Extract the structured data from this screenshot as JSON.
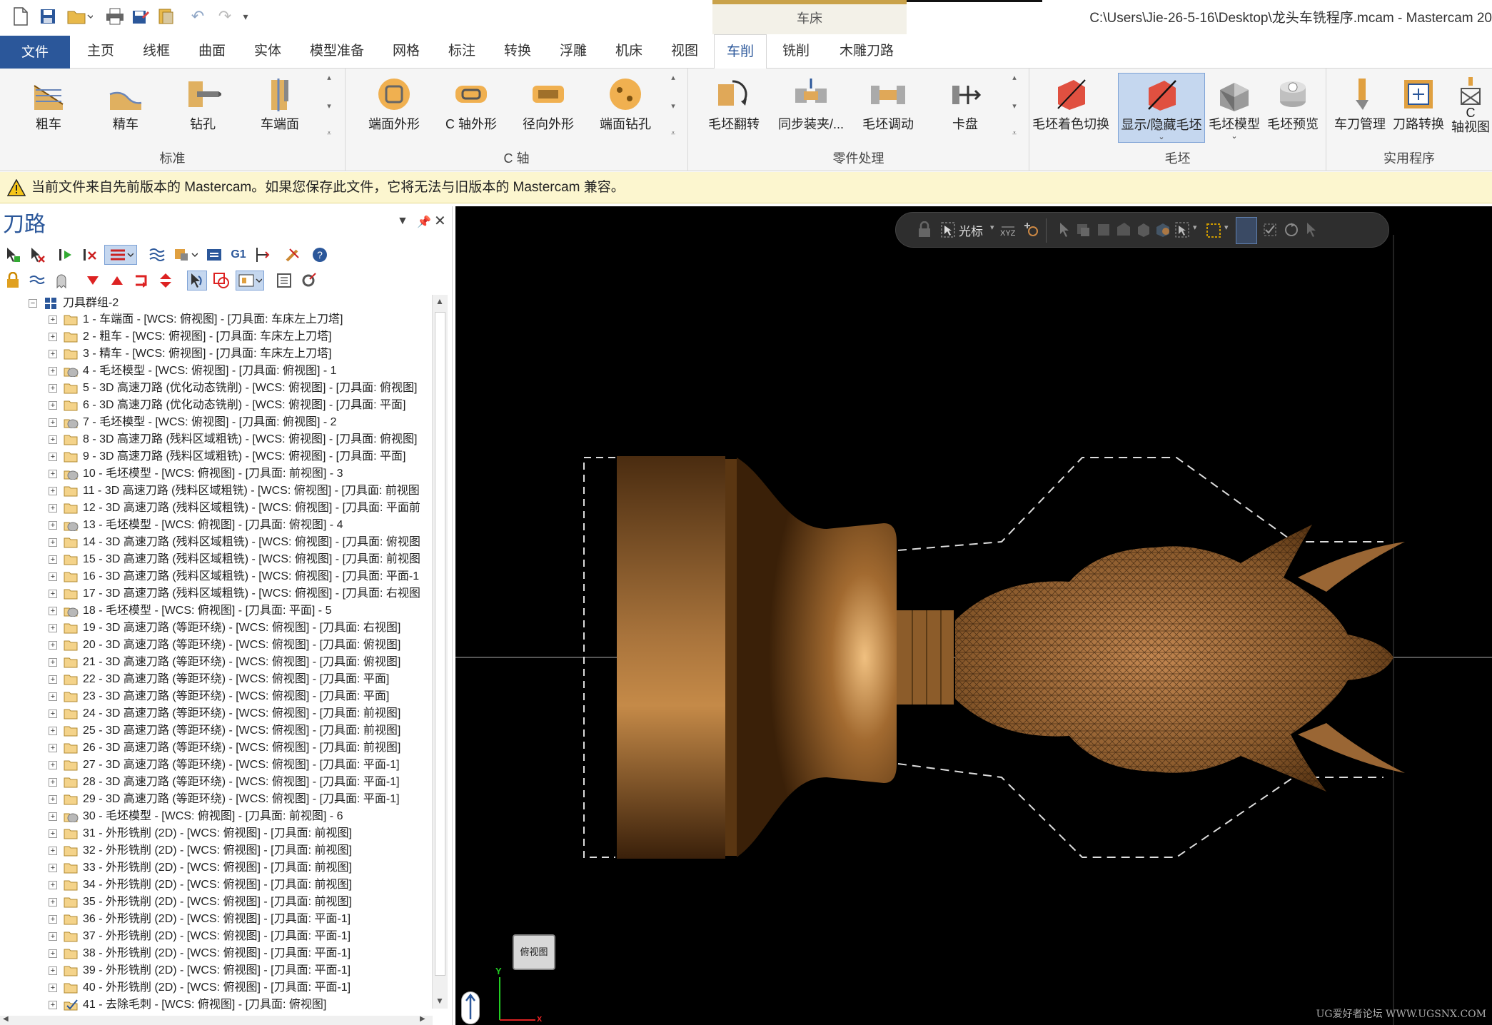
{
  "window": {
    "title": "C:\\Users\\Jie-26-5-16\\Desktop\\龙头车铣程序.mcam - Mastercam 20",
    "context_group": "车床"
  },
  "tabs": [
    {
      "label": "文件"
    },
    {
      "label": "主页"
    },
    {
      "label": "线框"
    },
    {
      "label": "曲面"
    },
    {
      "label": "实体"
    },
    {
      "label": "模型准备"
    },
    {
      "label": "网格"
    },
    {
      "label": "标注"
    },
    {
      "label": "转换"
    },
    {
      "label": "浮雕"
    },
    {
      "label": "机床"
    },
    {
      "label": "视图"
    },
    {
      "label": "车削"
    },
    {
      "label": "铣削"
    },
    {
      "label": "木雕刀路"
    }
  ],
  "ribbon": {
    "standard": {
      "label": "标准",
      "buttons": [
        "粗车",
        "精车",
        "钻孔",
        "车端面"
      ]
    },
    "c_axis": {
      "label": "C 轴",
      "buttons": [
        "端面外形",
        "C 轴外形",
        "径向外形",
        "端面钻孔"
      ]
    },
    "part_handling": {
      "label": "零件处理",
      "buttons": [
        "毛坯翻转",
        "同步装夹/...",
        "毛坯调动",
        "卡盘"
      ]
    },
    "stock": {
      "label": "毛坯",
      "buttons": [
        "毛坯着色切换",
        "显示/隐藏毛坯",
        "毛坯模型",
        "毛坯预览"
      ]
    },
    "utilities": {
      "label": "实用程序",
      "buttons": [
        "车刀管理",
        "刀路转换",
        "C",
        "轴视图"
      ]
    }
  },
  "warning": "当前文件来自先前版本的 Mastercam。如果您保存此文件，它将无法与旧版本的 Mastercam 兼容。",
  "panel": {
    "title": "刀路",
    "root": "刀具群组-2",
    "rows": [
      {
        "text": "1 - 车端面 - [WCS: 俯视图] - [刀具面: 车床左上刀塔]",
        "icon": "folder"
      },
      {
        "text": "2 - 粗车 - [WCS: 俯视图] - [刀具面: 车床左上刀塔]",
        "icon": "folder"
      },
      {
        "text": "3 - 精车 - [WCS: 俯视图] - [刀具面: 车床左上刀塔]",
        "icon": "folder"
      },
      {
        "text": "4 - 毛坯模型 - [WCS: 俯视图] - [刀具面: 俯视图] - 1",
        "icon": "stock"
      },
      {
        "text": "5 - 3D 高速刀路 (优化动态铣削) - [WCS: 俯视图] - [刀具面: 俯视图]",
        "icon": "folder"
      },
      {
        "text": "6 - 3D 高速刀路 (优化动态铣削) - [WCS: 俯视图] - [刀具面: 平面]",
        "icon": "folder"
      },
      {
        "text": "7 - 毛坯模型 - [WCS: 俯视图] - [刀具面: 俯视图] - 2",
        "icon": "stock"
      },
      {
        "text": "8 - 3D 高速刀路 (残料区域粗铣) - [WCS: 俯视图] - [刀具面: 俯视图]",
        "icon": "folder"
      },
      {
        "text": "9 - 3D 高速刀路 (残料区域粗铣) - [WCS: 俯视图] - [刀具面: 平面]",
        "icon": "folder"
      },
      {
        "text": "10 - 毛坯模型 - [WCS: 俯视图] - [刀具面: 前视图] - 3",
        "icon": "stock"
      },
      {
        "text": "11 - 3D 高速刀路 (残料区域粗铣) - [WCS: 俯视图] - [刀具面: 前视图",
        "icon": "folder"
      },
      {
        "text": "12 - 3D 高速刀路 (残料区域粗铣) - [WCS: 俯视图] - [刀具面: 平面前",
        "icon": "folder"
      },
      {
        "text": "13 - 毛坯模型 - [WCS: 俯视图] - [刀具面: 俯视图] - 4",
        "icon": "stock"
      },
      {
        "text": "14 - 3D 高速刀路 (残料区域粗铣) - [WCS: 俯视图] - [刀具面: 俯视图",
        "icon": "folder"
      },
      {
        "text": "15 - 3D 高速刀路 (残料区域粗铣) - [WCS: 俯视图] - [刀具面: 前视图",
        "icon": "folder"
      },
      {
        "text": "16 - 3D 高速刀路 (残料区域粗铣) - [WCS: 俯视图] - [刀具面: 平面-1",
        "icon": "folder"
      },
      {
        "text": "17 - 3D 高速刀路 (残料区域粗铣) - [WCS: 俯视图] - [刀具面: 右视图",
        "icon": "folder"
      },
      {
        "text": "18 - 毛坯模型 - [WCS: 俯视图] - [刀具面: 平面] - 5",
        "icon": "stock"
      },
      {
        "text": "19 - 3D 高速刀路 (等距环绕) - [WCS: 俯视图] - [刀具面: 右视图]",
        "icon": "folder"
      },
      {
        "text": "20 - 3D 高速刀路 (等距环绕) - [WCS: 俯视图] - [刀具面: 俯视图]",
        "icon": "folder"
      },
      {
        "text": "21 - 3D 高速刀路 (等距环绕) - [WCS: 俯视图] - [刀具面: 俯视图]",
        "icon": "folder"
      },
      {
        "text": "22 - 3D 高速刀路 (等距环绕) - [WCS: 俯视图] - [刀具面: 平面]",
        "icon": "folder"
      },
      {
        "text": "23 - 3D 高速刀路 (等距环绕) - [WCS: 俯视图] - [刀具面: 平面]",
        "icon": "folder"
      },
      {
        "text": "24 - 3D 高速刀路 (等距环绕) - [WCS: 俯视图] - [刀具面: 前视图]",
        "icon": "folder"
      },
      {
        "text": "25 - 3D 高速刀路 (等距环绕) - [WCS: 俯视图] - [刀具面: 前视图]",
        "icon": "folder"
      },
      {
        "text": "26 - 3D 高速刀路 (等距环绕) - [WCS: 俯视图] - [刀具面: 前视图]",
        "icon": "folder"
      },
      {
        "text": "27 - 3D 高速刀路 (等距环绕) - [WCS: 俯视图] - [刀具面: 平面-1]",
        "icon": "folder"
      },
      {
        "text": "28 - 3D 高速刀路 (等距环绕) - [WCS: 俯视图] - [刀具面: 平面-1]",
        "icon": "folder"
      },
      {
        "text": "29 - 3D 高速刀路 (等距环绕) - [WCS: 俯视图] - [刀具面: 平面-1]",
        "icon": "folder"
      },
      {
        "text": "30 - 毛坯模型 - [WCS: 俯视图] - [刀具面: 前视图] - 6",
        "icon": "stock"
      },
      {
        "text": "31 - 外形铣削 (2D) - [WCS: 俯视图] - [刀具面: 前视图]",
        "icon": "folder"
      },
      {
        "text": "32 - 外形铣削 (2D) - [WCS: 俯视图] - [刀具面: 前视图]",
        "icon": "folder"
      },
      {
        "text": "33 - 外形铣削 (2D) - [WCS: 俯视图] - [刀具面: 前视图]",
        "icon": "folder"
      },
      {
        "text": "34 - 外形铣削 (2D) - [WCS: 俯视图] - [刀具面: 前视图]",
        "icon": "folder"
      },
      {
        "text": "35 - 外形铣削 (2D) - [WCS: 俯视图] - [刀具面: 前视图]",
        "icon": "folder"
      },
      {
        "text": "36 - 外形铣削 (2D) - [WCS: 俯视图] - [刀具面: 平面-1]",
        "icon": "folder"
      },
      {
        "text": "37 - 外形铣削 (2D) - [WCS: 俯视图] - [刀具面: 平面-1]",
        "icon": "folder"
      },
      {
        "text": "38 - 外形铣削 (2D) - [WCS: 俯视图] - [刀具面: 平面-1]",
        "icon": "folder"
      },
      {
        "text": "39 - 外形铣削 (2D) - [WCS: 俯视图] - [刀具面: 平面-1]",
        "icon": "folder"
      },
      {
        "text": "40 - 外形铣削 (2D) - [WCS: 俯视图] - [刀具面: 平面-1]",
        "icon": "folder"
      },
      {
        "text": "41 - 去除毛刺 - [WCS: 俯视图] - [刀具面: 俯视图]",
        "icon": "check"
      }
    ]
  },
  "viewport": {
    "toolbar_cursor_label": "光标",
    "gview_label": "俯视图",
    "watermark": "UG爱好者论坛 WWW.UGSNX.COM",
    "axis_x": "x",
    "axis_y": "Y"
  },
  "colors": {
    "accent": "#2b579a",
    "part": "#8a5a2c",
    "warning_bg": "#fcf6cf"
  }
}
